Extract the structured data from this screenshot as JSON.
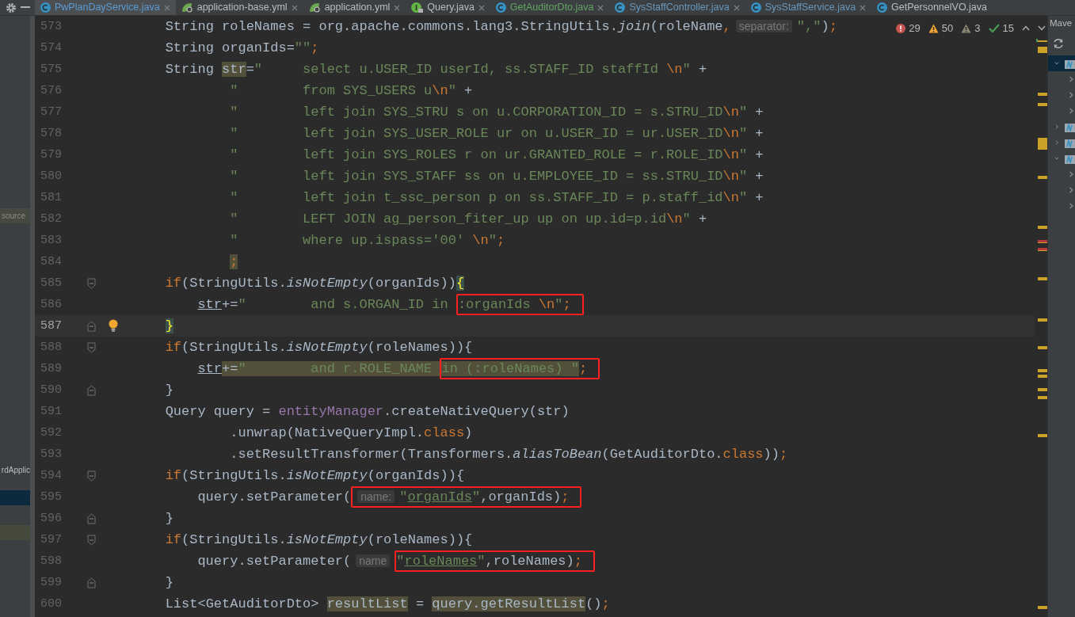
{
  "tabs": [
    {
      "label": "PwPlanDayService.java",
      "kind": "class",
      "selected": true,
      "closable": true,
      "color": "#5b9bd5"
    },
    {
      "label": "application-base.yml",
      "kind": "yml",
      "selected": false,
      "closable": true,
      "color": "#bbbbbb"
    },
    {
      "label": "application.yml",
      "kind": "yml",
      "selected": false,
      "closable": true,
      "color": "#bbbbbb"
    },
    {
      "label": "Query.java",
      "kind": "interface",
      "selected": false,
      "closable": true,
      "color": "#bbbbbb"
    },
    {
      "label": "GetAuditorDto.java",
      "kind": "class",
      "selected": false,
      "closable": true,
      "color": "#62a362"
    },
    {
      "label": "SysStaffController.java",
      "kind": "class",
      "selected": false,
      "closable": true,
      "color": "#6897bb"
    },
    {
      "label": "SysStaffService.java",
      "kind": "class",
      "selected": false,
      "closable": true,
      "color": "#6897bb"
    },
    {
      "label": "GetPersonnelVO.java",
      "kind": "class",
      "selected": false,
      "closable": false,
      "color": "#bbbbbb"
    }
  ],
  "project_panel": {
    "rows": [
      {
        "label": "source",
        "kind": "source_root",
        "selected": false
      },
      {
        "label": "rdApplic",
        "kind": "item",
        "selected": false
      },
      {
        "kind": "item",
        "selected": true
      },
      {
        "kind": "match",
        "selected": false
      }
    ]
  },
  "inspections": [
    {
      "kind": "error",
      "count": "29"
    },
    {
      "kind": "warning",
      "count": "50"
    },
    {
      "kind": "weak_warning",
      "count": "3"
    },
    {
      "kind": "typo",
      "count": "15"
    }
  ],
  "editor": {
    "lines": [
      {
        "number": "573",
        "current": false,
        "tokens": [
          {
            "text": "        String roleNames = org.apache.commons.lang3.StringUtils.",
            "kind": "plain"
          },
          {
            "text": "join",
            "kind": "method"
          },
          {
            "text": "(roleName",
            "kind": "plain"
          },
          {
            "text": ",",
            "kind": "keyword"
          },
          {
            "text": "separator:",
            "kind": "hint"
          },
          {
            "text": "\",\"",
            "kind": "string"
          },
          {
            "text": ")",
            "kind": "plain"
          },
          {
            "text": ";",
            "kind": "keyword"
          }
        ]
      },
      {
        "number": "574",
        "current": false,
        "tokens": [
          {
            "text": "        String organIds=",
            "kind": "plain"
          },
          {
            "text": "\"\"",
            "kind": "string"
          },
          {
            "text": ";",
            "kind": "keyword"
          }
        ]
      },
      {
        "number": "575",
        "current": false,
        "tokens": [
          {
            "text": "        String ",
            "kind": "plain"
          },
          {
            "text": "str",
            "kind": "usage"
          },
          {
            "text": "=",
            "kind": "plain"
          },
          {
            "text": "\"     select u.USER_ID userId, ss.STAFF_ID staffId ",
            "kind": "string"
          },
          {
            "text": "\\n",
            "kind": "escape"
          },
          {
            "text": "\"",
            "kind": "string"
          },
          {
            "text": " +",
            "kind": "plain"
          }
        ]
      },
      {
        "number": "576",
        "current": false,
        "tokens": [
          {
            "text": "                \"        from SYS_USERS u",
            "kind": "string"
          },
          {
            "text": "\\n",
            "kind": "escape"
          },
          {
            "text": "\"",
            "kind": "string"
          },
          {
            "text": " +",
            "kind": "plain"
          }
        ]
      },
      {
        "number": "577",
        "current": false,
        "tokens": [
          {
            "text": "                \"        left join SYS_STRU s on u.CORPORATION_ID = s.STRU_ID",
            "kind": "string"
          },
          {
            "text": "\\n",
            "kind": "escape"
          },
          {
            "text": "\"",
            "kind": "string"
          },
          {
            "text": " +",
            "kind": "plain"
          }
        ]
      },
      {
        "number": "578",
        "current": false,
        "tokens": [
          {
            "text": "                \"        left join SYS_USER_ROLE ur on u.USER_ID = ur.USER_ID",
            "kind": "string"
          },
          {
            "text": "\\n",
            "kind": "escape"
          },
          {
            "text": "\"",
            "kind": "string"
          },
          {
            "text": " +",
            "kind": "plain"
          }
        ]
      },
      {
        "number": "579",
        "current": false,
        "tokens": [
          {
            "text": "                \"        left join SYS_ROLES r on ur.GRANTED_ROLE = r.ROLE_ID",
            "kind": "string"
          },
          {
            "text": "\\n",
            "kind": "escape"
          },
          {
            "text": "\"",
            "kind": "string"
          },
          {
            "text": " +",
            "kind": "plain"
          }
        ]
      },
      {
        "number": "580",
        "current": false,
        "tokens": [
          {
            "text": "                \"        left join SYS_STAFF ss on u.EMPLOYEE_ID = ss.STRU_ID",
            "kind": "string"
          },
          {
            "text": "\\n",
            "kind": "escape"
          },
          {
            "text": "\"",
            "kind": "string"
          },
          {
            "text": " +",
            "kind": "plain"
          }
        ]
      },
      {
        "number": "581",
        "current": false,
        "tokens": [
          {
            "text": "                \"        left join t_ssc_person p on ss.STAFF_ID = p.staff_id",
            "kind": "string"
          },
          {
            "text": "\\n",
            "kind": "escape"
          },
          {
            "text": "\"",
            "kind": "string"
          },
          {
            "text": " +",
            "kind": "plain"
          }
        ]
      },
      {
        "number": "582",
        "current": false,
        "tokens": [
          {
            "text": "                \"        LEFT JOIN ag_person_fiter_up up on up.id=p.id",
            "kind": "string"
          },
          {
            "text": "\\n",
            "kind": "escape"
          },
          {
            "text": "\"",
            "kind": "string"
          },
          {
            "text": " +",
            "kind": "plain"
          }
        ]
      },
      {
        "number": "583",
        "current": false,
        "tokens": [
          {
            "text": "                \"        where up.ispass='00' ",
            "kind": "string"
          },
          {
            "text": "\\n",
            "kind": "escape"
          },
          {
            "text": "\"",
            "kind": "string"
          },
          {
            "text": ";",
            "kind": "keyword"
          }
        ]
      },
      {
        "number": "584",
        "current": false,
        "tokens": [
          {
            "text": "                ;",
            "kind": "usage_keyword"
          }
        ]
      },
      {
        "number": "585",
        "current": false,
        "kind": "fold_start",
        "tokens": [
          {
            "text": "        if",
            "kind": "keyword"
          },
          {
            "text": "(StringUtils.",
            "kind": "plain"
          },
          {
            "text": "isNotEmpty",
            "kind": "method"
          },
          {
            "text": "(organIds))",
            "kind": "plain"
          },
          {
            "text": "{",
            "kind": "brace"
          }
        ]
      },
      {
        "number": "586",
        "current": false,
        "tokens": [
          {
            "text": "            str",
            "kind": "var"
          },
          {
            "text": "+=",
            "kind": "plain"
          },
          {
            "text": "\"        and s.ORGAN_ID in ",
            "kind": "string"
          }
        ],
        "boxed_tokens": [
          {
            "text": ":organIds ",
            "kind": "string"
          },
          {
            "text": "\\n",
            "kind": "escape"
          },
          {
            "text": "\"",
            "kind": "string"
          },
          {
            "text": ";",
            "kind": "keyword"
          }
        ]
      },
      {
        "number": "587",
        "current": true,
        "kind": "fold_end_bulb",
        "tokens": [
          {
            "text": "        }",
            "kind": "brace"
          }
        ]
      },
      {
        "number": "588",
        "current": false,
        "kind": "fold_start",
        "tokens": [
          {
            "text": "        if",
            "kind": "keyword"
          },
          {
            "text": "(StringUtils.",
            "kind": "plain"
          },
          {
            "text": "isNotEmpty",
            "kind": "method"
          },
          {
            "text": "(roleNames)){",
            "kind": "plain"
          }
        ]
      },
      {
        "number": "589",
        "current": false,
        "tokens": [
          {
            "text": "            str",
            "kind": "var"
          },
          {
            "text": "+=",
            "kind": "usage"
          },
          {
            "text": "\"        and r.ROLE_NAME ",
            "kind": "usage_string"
          }
        ],
        "boxed_tokens": [
          {
            "text": "in (:roleNames) \"",
            "kind": "usage_string"
          },
          {
            "text": ";",
            "kind": "keyword"
          }
        ]
      },
      {
        "number": "590",
        "current": false,
        "kind": "fold_end",
        "tokens": [
          {
            "text": "        }",
            "kind": "plain"
          }
        ]
      },
      {
        "number": "591",
        "current": false,
        "tokens": [
          {
            "text": "        Query query = ",
            "kind": "plain"
          },
          {
            "text": "entityManager",
            "kind": "field"
          },
          {
            "text": ".createNativeQuery(str)",
            "kind": "plain"
          }
        ]
      },
      {
        "number": "592",
        "current": false,
        "tokens": [
          {
            "text": "                .unwrap(NativeQueryImpl.",
            "kind": "plain"
          },
          {
            "text": "class",
            "kind": "keyword"
          },
          {
            "text": ")",
            "kind": "plain"
          }
        ]
      },
      {
        "number": "593",
        "current": false,
        "tokens": [
          {
            "text": "                .setResultTransformer(Transformers.",
            "kind": "plain"
          },
          {
            "text": "aliasToBean",
            "kind": "method"
          },
          {
            "text": "(GetAuditorDto.",
            "kind": "plain"
          },
          {
            "text": "class",
            "kind": "keyword"
          },
          {
            "text": "))",
            "kind": "plain"
          },
          {
            "text": ";",
            "kind": "keyword"
          }
        ]
      },
      {
        "number": "594",
        "current": false,
        "kind": "fold_start",
        "tokens": [
          {
            "text": "        if",
            "kind": "keyword"
          },
          {
            "text": "(StringUtils.",
            "kind": "plain"
          },
          {
            "text": "isNotEmpty",
            "kind": "method"
          },
          {
            "text": "(organIds)){",
            "kind": "plain"
          }
        ]
      },
      {
        "number": "595",
        "current": false,
        "tokens": [
          {
            "text": "            query.setParameter(",
            "kind": "plain"
          }
        ],
        "boxed_tokens": [
          {
            "text": "name:",
            "kind": "hint"
          },
          {
            "text": "\"",
            "kind": "string"
          },
          {
            "text": "organIds",
            "kind": "string_link"
          },
          {
            "text": "\"",
            "kind": "string"
          },
          {
            "text": ",organIds)",
            "kind": "plain"
          },
          {
            "text": ";",
            "kind": "keyword"
          }
        ]
      },
      {
        "number": "596",
        "current": false,
        "kind": "fold_end",
        "tokens": [
          {
            "text": "        }",
            "kind": "plain"
          }
        ]
      },
      {
        "number": "597",
        "current": false,
        "kind": "fold_start",
        "tokens": [
          {
            "text": "        if",
            "kind": "keyword"
          },
          {
            "text": "(StringUtils.",
            "kind": "plain"
          },
          {
            "text": "isNotEmpty",
            "kind": "method"
          },
          {
            "text": "(roleNames)){",
            "kind": "plain"
          }
        ]
      },
      {
        "number": "598",
        "current": false,
        "tokens": [
          {
            "text": "            query.setParameter(",
            "kind": "plain"
          },
          {
            "text": "name",
            "kind": "hint"
          }
        ],
        "boxed_tokens": [
          {
            "text": "\"",
            "kind": "string"
          },
          {
            "text": "roleNames",
            "kind": "string_link"
          },
          {
            "text": "\"",
            "kind": "string"
          },
          {
            "text": ",roleNames)",
            "kind": "plain"
          },
          {
            "text": ";",
            "kind": "keyword"
          }
        ]
      },
      {
        "number": "599",
        "current": false,
        "kind": "fold_end",
        "tokens": [
          {
            "text": "        }",
            "kind": "plain"
          }
        ]
      },
      {
        "number": "600",
        "current": false,
        "tokens": [
          {
            "text": "        List<GetAuditorDto> ",
            "kind": "plain"
          },
          {
            "text": "resultList",
            "kind": "usage"
          },
          {
            "text": " = ",
            "kind": "plain"
          },
          {
            "text": "query.getResultList",
            "kind": "usage"
          },
          {
            "text": "()",
            "kind": "plain"
          },
          {
            "text": ";",
            "kind": "keyword"
          }
        ]
      }
    ]
  },
  "maven_panel": {
    "title": "Mave",
    "tree": [
      {
        "expanded": true,
        "selected": true,
        "children": [
          {
            "expanded": false,
            "selected": false
          },
          {
            "expanded": false,
            "selected": false
          },
          {
            "expanded": false,
            "selected": false
          }
        ]
      },
      {
        "expanded": false,
        "selected": false
      },
      {
        "expanded": false,
        "selected": false
      },
      {
        "expanded": true,
        "selected": false,
        "children": [
          {
            "expanded": false,
            "selected": false
          },
          {
            "expanded": false,
            "selected": false
          },
          {
            "expanded": false,
            "selected": false
          }
        ]
      }
    ]
  }
}
